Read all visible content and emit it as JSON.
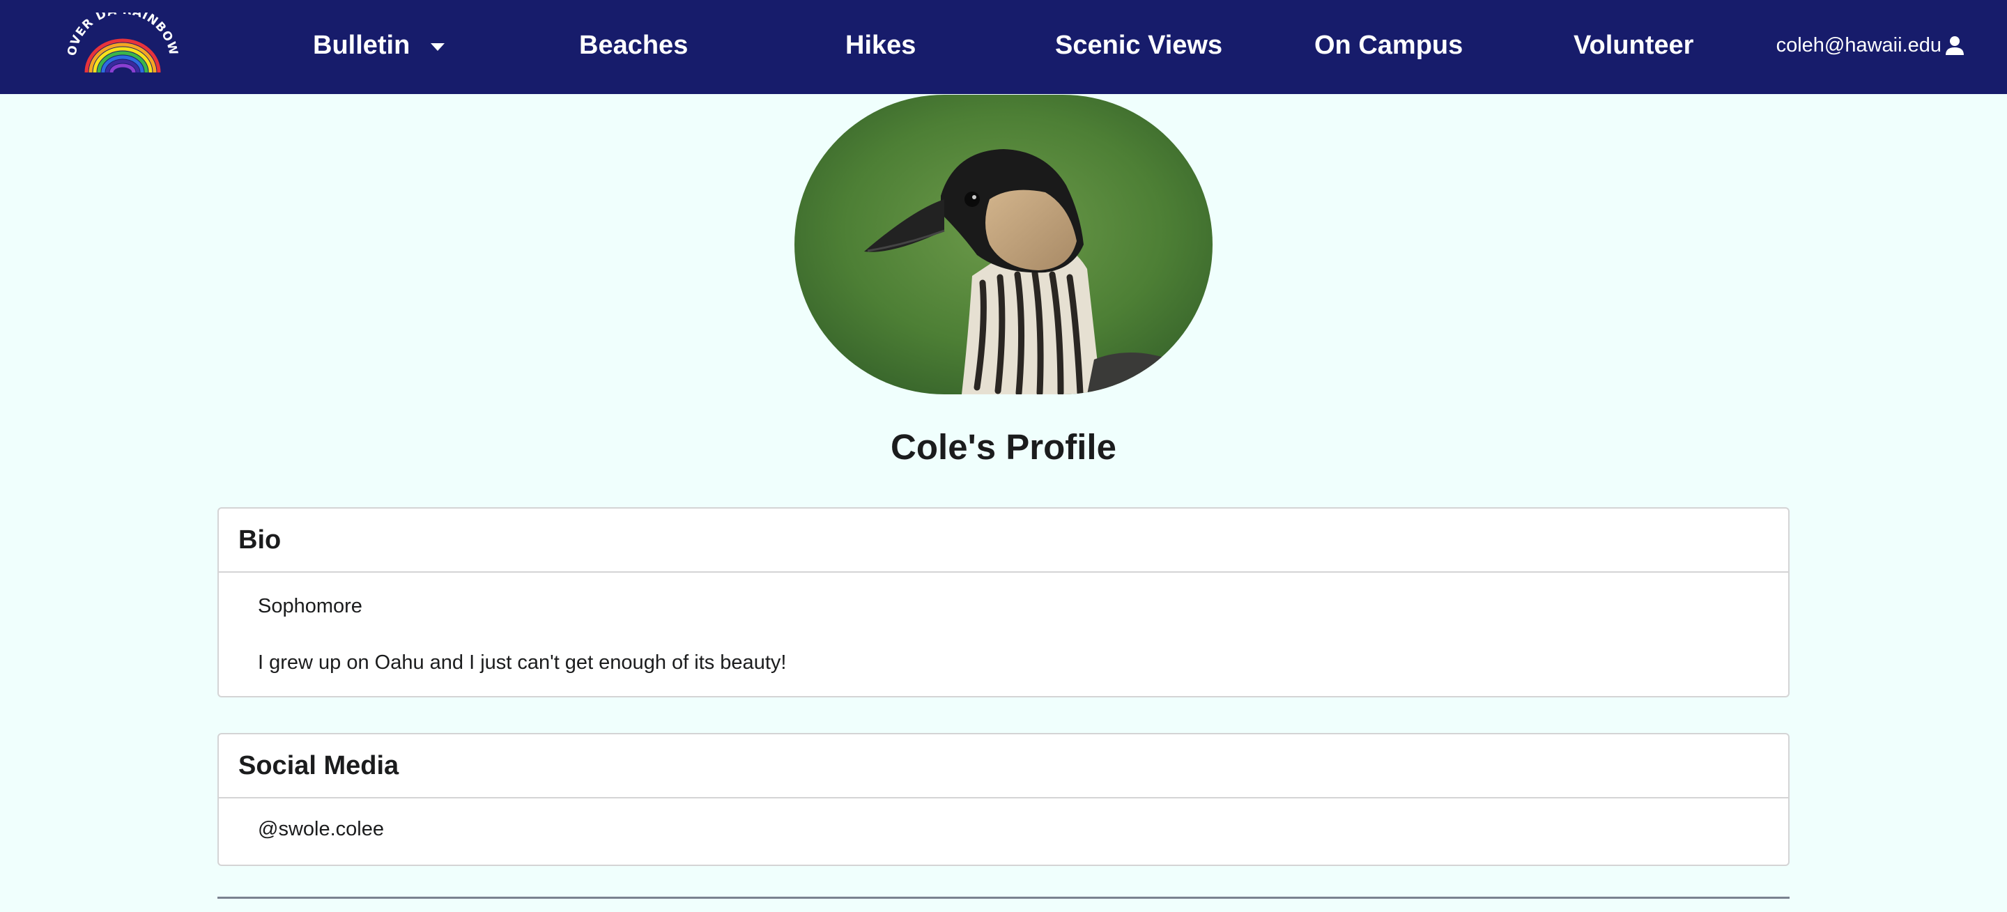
{
  "navbar": {
    "logo_text": "OVER DA RAINBOW",
    "items": [
      {
        "label": "Bulletin",
        "has_dropdown": true
      },
      {
        "label": "Beaches"
      },
      {
        "label": "Hikes"
      },
      {
        "label": "Scenic Views"
      },
      {
        "label": "On Campus"
      },
      {
        "label": "Volunteer"
      }
    ],
    "user_email": "coleh@hawaii.edu",
    "user_icon": "user-icon"
  },
  "profile": {
    "avatar_icon": "nene-goose-photo",
    "title": "Cole's Profile"
  },
  "bio": {
    "header": "Bio",
    "year": "Sophomore",
    "text": "I grew up on Oahu and I just can't get enough of its beauty!"
  },
  "social": {
    "header": "Social Media",
    "handle": "@swole.colee"
  },
  "colors": {
    "navbar": "#171c6b",
    "background": "#f0fffd",
    "card_border": "#d4d4d5"
  }
}
